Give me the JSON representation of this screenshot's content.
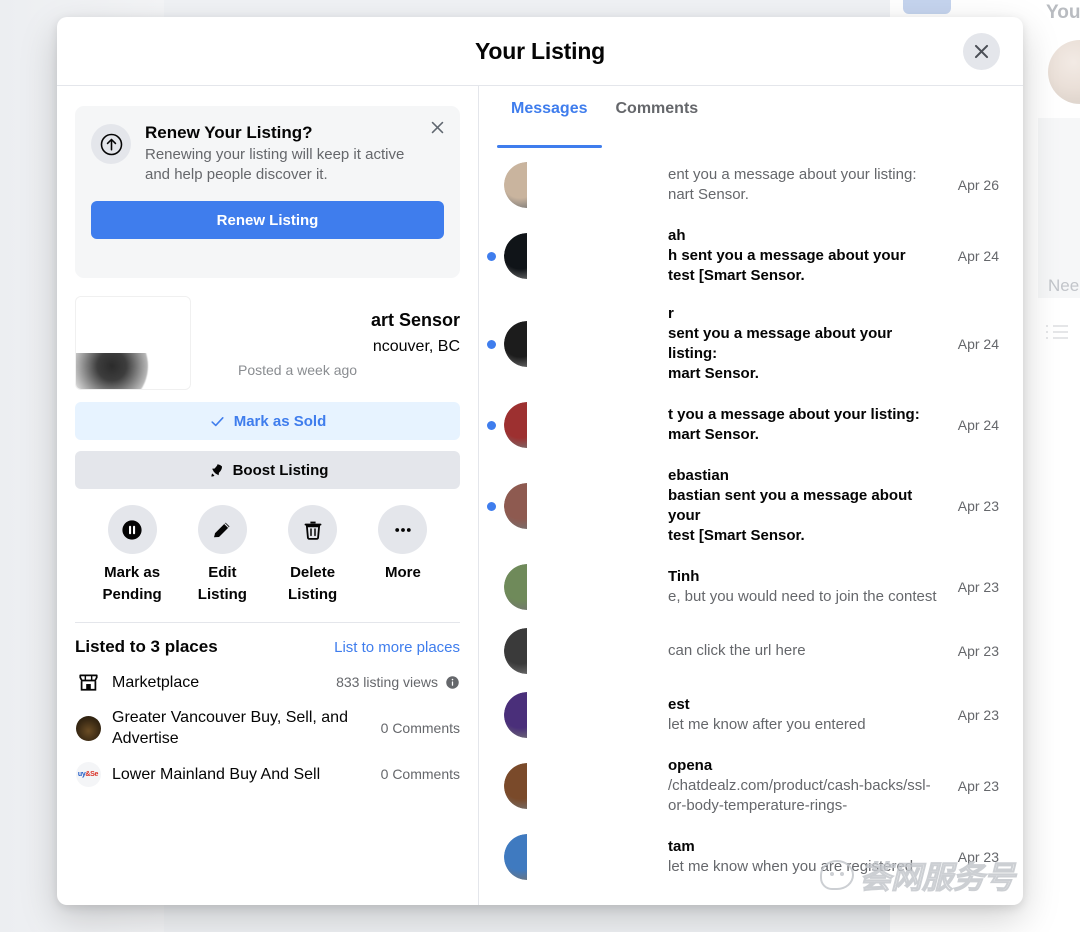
{
  "background": {
    "you_text": "You",
    "need_text": "Nee"
  },
  "modal": {
    "title": "Your Listing",
    "close_icon": "close-icon"
  },
  "renew_card": {
    "icon": "arrow-up-circle-icon",
    "title": "Renew Your Listing?",
    "description": "Renewing your listing will keep it active and help people discover it.",
    "button_label": "Renew Listing",
    "dismiss_icon": "close-icon"
  },
  "listing": {
    "title": "art Sensor",
    "location": "ncouver, BC",
    "posted": "Posted a week ago",
    "mark_sold_label": "Mark as Sold",
    "mark_sold_icon": "check-icon",
    "boost_label": "Boost Listing",
    "boost_icon": "rocket-icon"
  },
  "icon_actions": [
    {
      "name": "mark-as-pending",
      "icon": "pause-circle-icon",
      "label": "Mark as\nPending"
    },
    {
      "name": "edit-listing",
      "icon": "pencil-icon",
      "label": "Edit\nListing"
    },
    {
      "name": "delete-listing",
      "icon": "trash-icon",
      "label": "Delete\nListing"
    },
    {
      "name": "more",
      "icon": "ellipsis-icon",
      "label": "More"
    }
  ],
  "places": {
    "heading": "Listed to 3 places",
    "link_label": "List to more places",
    "items": [
      {
        "name": "Marketplace",
        "meta": "833 listing views",
        "icon": "storefront-icon",
        "has_info": true
      },
      {
        "name": "Greater Vancouver Buy, Sell, and Advertise",
        "meta": "0 Comments",
        "icon": "group-avatar",
        "has_info": false
      },
      {
        "name": "Lower Mainland Buy And Sell",
        "meta": "0 Comments",
        "icon": "group-avatar-2",
        "has_info": false
      }
    ]
  },
  "right_panel": {
    "tabs": [
      {
        "label": "Messages",
        "active": true
      },
      {
        "label": "Comments",
        "active": false
      }
    ],
    "messages": [
      {
        "name": "",
        "snippet": "ent you a message about your listing:\nnart Sensor.",
        "date": "Apr 26",
        "unread": false,
        "avatar_color": "#c9b49e"
      },
      {
        "name": "ah",
        "snippet": "h sent you a message about your\ntest [Smart Sensor.",
        "date": "Apr 24",
        "unread": true,
        "avatar_color": "#101418"
      },
      {
        "name": "r",
        "snippet": "sent you a message about your listing:\nmart Sensor.",
        "date": "Apr 24",
        "unread": true,
        "avatar_color": "#1c1c1c"
      },
      {
        "name": "",
        "snippet": "t you a message about your listing:\nmart Sensor.",
        "date": "Apr 24",
        "unread": true,
        "avatar_color": "#9d3030"
      },
      {
        "name": "ebastian",
        "snippet": "bastian sent you a message about your\ntest [Smart Sensor.",
        "date": "Apr 23",
        "unread": true,
        "avatar_color": "#8e5a50"
      },
      {
        "name": "Tinh",
        "snippet": "e, but you would need to join the contest",
        "date": "Apr 23",
        "unread": false,
        "avatar_color": "#6f8a5a"
      },
      {
        "name": "",
        "snippet": "can click the url here",
        "date": "Apr 23",
        "unread": false,
        "avatar_color": "#3a3a3a"
      },
      {
        "name": "est",
        "snippet": "let me know after you entered",
        "date": "Apr 23",
        "unread": false,
        "avatar_color": "#4a2f7a"
      },
      {
        "name": "opena",
        "snippet": "/chatdealz.com/product/cash-backs/ssl-\nor-body-temperature-rings-",
        "date": "Apr 23",
        "unread": false,
        "avatar_color": "#7a4a2a"
      },
      {
        "name": "tam",
        "snippet": "let me know when you are registered",
        "date": "Apr 23",
        "unread": false,
        "avatar_color": "#3f7ac0"
      }
    ]
  },
  "watermark": {
    "text": "荟网服务号"
  }
}
